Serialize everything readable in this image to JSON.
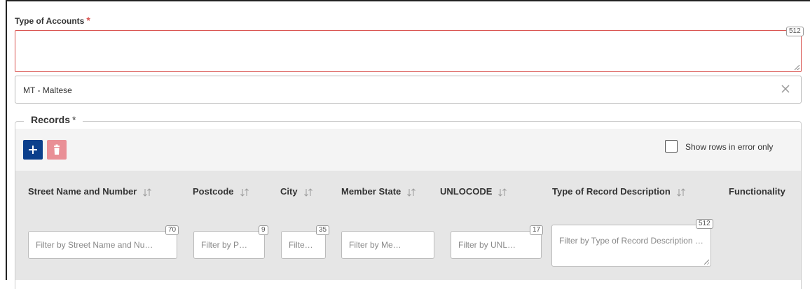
{
  "type_of_accounts": {
    "label": "Type of Accounts",
    "required_mark": "*",
    "value": "",
    "counter": "512"
  },
  "language_select": {
    "value": "MT - Maltese",
    "clear_icon": "close-icon"
  },
  "records": {
    "legend": "Records",
    "required_mark": "*",
    "add_icon": "plus-icon",
    "delete_icon": "trash-icon",
    "show_errors_label": "Show rows in error only",
    "show_errors_checked": false,
    "columns": [
      {
        "title": "Street Name and Number",
        "sortable": true,
        "filter_placeholder": "Filter by Street Name and Nu…",
        "counter": "70"
      },
      {
        "title": "Postcode",
        "sortable": true,
        "filter_placeholder": "Filter by P…",
        "counter": "9"
      },
      {
        "title": "City",
        "sortable": true,
        "filter_placeholder": "Filte…",
        "counter": "35"
      },
      {
        "title": "Member State",
        "sortable": true,
        "filter_placeholder": "Filter by Me…",
        "counter": ""
      },
      {
        "title": "UNLOCODE",
        "sortable": true,
        "filter_placeholder": "Filter by UNL…",
        "counter": "17"
      },
      {
        "title": "Type of Record Description",
        "sortable": true,
        "filter_placeholder": "Filter by Type of Record Description …",
        "counter": "512"
      },
      {
        "title": "Functionality",
        "sortable": false
      }
    ]
  }
}
